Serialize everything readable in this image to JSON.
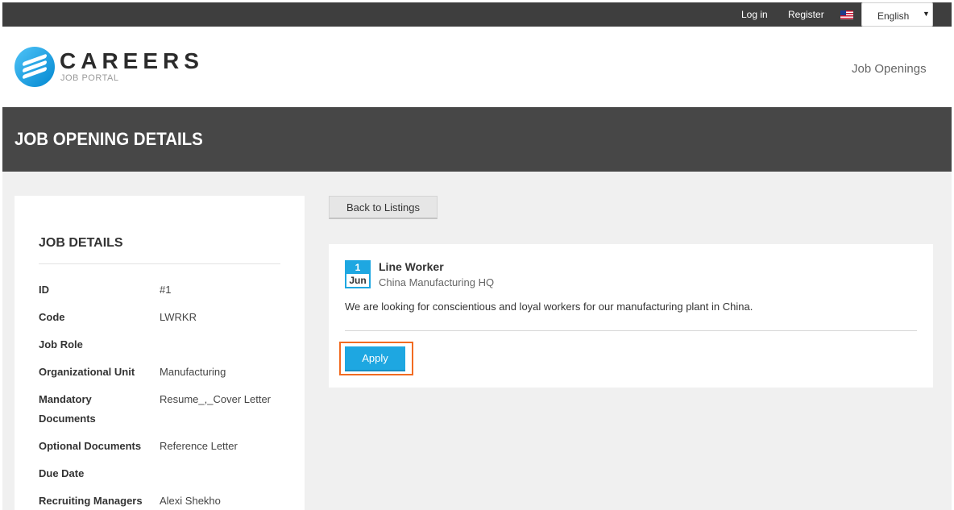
{
  "topbar": {
    "login": "Log in",
    "register": "Register",
    "language": "English",
    "flag_icon": "us-flag-icon"
  },
  "header": {
    "logo_title": "CAREERS",
    "logo_subtitle": "JOB PORTAL",
    "nav_link": "Job Openings"
  },
  "banner": {
    "title": "JOB OPENING DETAILS"
  },
  "details": {
    "title": "JOB DETAILS",
    "rows": [
      {
        "label": "ID",
        "value": "#1"
      },
      {
        "label": "Code",
        "value": "LWRKR"
      },
      {
        "label": "Job Role",
        "value": ""
      },
      {
        "label": "Organizational Unit",
        "value": "Manufacturing"
      },
      {
        "label": "Mandatory Documents",
        "value": "Resume_,_Cover Letter"
      },
      {
        "label": "Optional Documents",
        "value": "Reference Letter"
      },
      {
        "label": "Due Date",
        "value": ""
      },
      {
        "label": "Recruiting Managers",
        "value": "Alexi Shekho"
      }
    ]
  },
  "main": {
    "back_label": "Back to Listings",
    "job": {
      "day": "1",
      "month": "Jun",
      "title": "Line Worker",
      "location": "China Manufacturing HQ",
      "description": "We are looking for conscientious and loyal workers for our manufacturing plant in China.",
      "apply_label": "Apply"
    }
  },
  "colors": {
    "accent": "#1ea7e1",
    "highlight": "#f26b21",
    "topbar": "#3e3e3e",
    "banner": "#474747"
  }
}
